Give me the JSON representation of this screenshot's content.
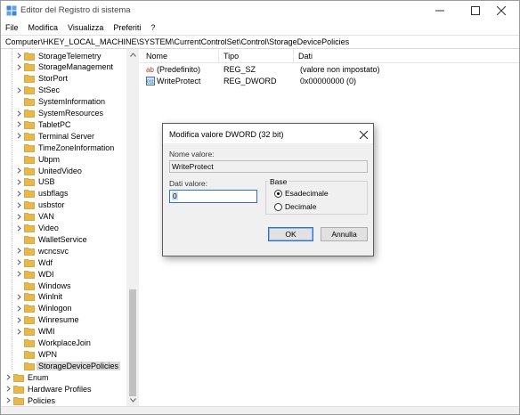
{
  "window": {
    "title": "Editor del Registro di sistema",
    "icon": "regedit-icon"
  },
  "menubar": {
    "items": [
      "File",
      "Modifica",
      "Visualizza",
      "Preferiti",
      "?"
    ]
  },
  "address": {
    "path": "Computer\\HKEY_LOCAL_MACHINE\\SYSTEM\\CurrentControlSet\\Control\\StorageDevicePolicies"
  },
  "tree": {
    "items": [
      {
        "label": "StorageTelemetry",
        "expandable": true
      },
      {
        "label": "StorageManagement",
        "expandable": true
      },
      {
        "label": "StorPort",
        "expandable": false
      },
      {
        "label": "StSec",
        "expandable": true
      },
      {
        "label": "SystemInformation",
        "expandable": false
      },
      {
        "label": "SystemResources",
        "expandable": true
      },
      {
        "label": "TabletPC",
        "expandable": true
      },
      {
        "label": "Terminal Server",
        "expandable": true
      },
      {
        "label": "TimeZoneInformation",
        "expandable": false
      },
      {
        "label": "Ubpm",
        "expandable": false
      },
      {
        "label": "UnitedVideo",
        "expandable": true
      },
      {
        "label": "USB",
        "expandable": true
      },
      {
        "label": "usbflags",
        "expandable": true
      },
      {
        "label": "usbstor",
        "expandable": true
      },
      {
        "label": "VAN",
        "expandable": true
      },
      {
        "label": "Video",
        "expandable": true
      },
      {
        "label": "WalletService",
        "expandable": false
      },
      {
        "label": "wcncsvc",
        "expandable": true
      },
      {
        "label": "Wdf",
        "expandable": true
      },
      {
        "label": "WDI",
        "expandable": true
      },
      {
        "label": "Windows",
        "expandable": false
      },
      {
        "label": "Winlnit",
        "expandable": true
      },
      {
        "label": "Winlogon",
        "expandable": true
      },
      {
        "label": "Winresume",
        "expandable": true
      },
      {
        "label": "WMI",
        "expandable": true
      },
      {
        "label": "WorkplaceJoin",
        "expandable": false
      },
      {
        "label": "WPN",
        "expandable": false
      },
      {
        "label": "StorageDevicePolicies",
        "expandable": false,
        "selected": true
      }
    ],
    "root_items": [
      {
        "label": "Enum",
        "expandable": true
      },
      {
        "label": "Hardware Profiles",
        "expandable": true
      },
      {
        "label": "Policies",
        "expandable": true
      }
    ]
  },
  "list": {
    "columns": [
      "Nome",
      "Tipo",
      "Dati"
    ],
    "rows": [
      {
        "name": "(Predefinito)",
        "type": "REG_SZ",
        "data": "(valore non impostato)",
        "icon": "string-value-icon"
      },
      {
        "name": "WriteProtect",
        "type": "REG_DWORD",
        "data": "0x00000000 (0)",
        "icon": "dword-value-icon"
      }
    ]
  },
  "dialog": {
    "title": "Modifica valore DWORD (32 bit)",
    "name_label": "Nome valore:",
    "name_value": "WriteProtect",
    "data_label": "Dati valore:",
    "data_value": "0",
    "base_label": "Base",
    "radio_hex": "Esadecimale",
    "radio_dec": "Decimale",
    "selected_base": "Esadecimale",
    "ok_label": "OK",
    "cancel_label": "Annulla"
  },
  "colors": {
    "folder": "#e8b84a",
    "accent": "#2e6fd1",
    "selection": "#d9d9d9"
  }
}
